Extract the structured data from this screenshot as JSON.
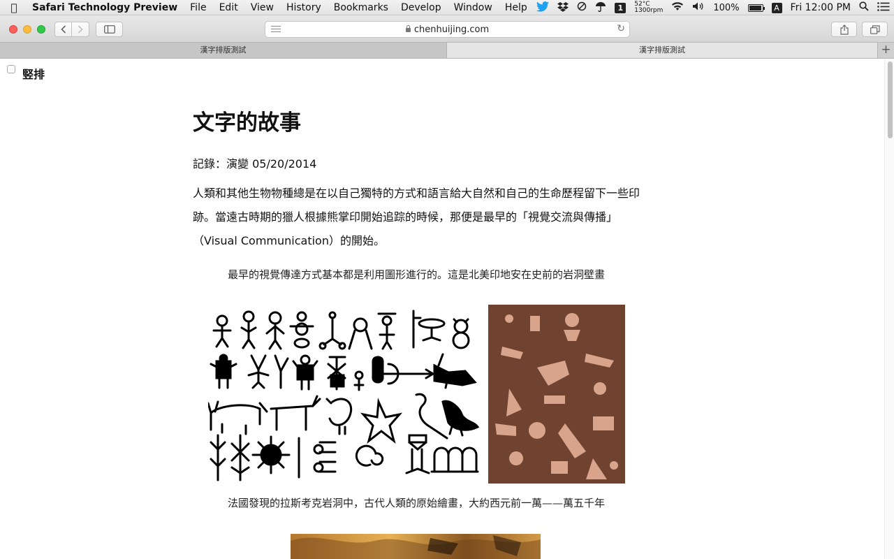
{
  "menubar": {
    "app_name": "Safari Technology Preview",
    "items": [
      "File",
      "Edit",
      "View",
      "History",
      "Bookmarks",
      "Develop",
      "Window",
      "Help"
    ],
    "status": {
      "temperature": "52°C",
      "fan": "1300rpm",
      "badge_number": "1",
      "battery": "100%",
      "input_source": "A",
      "clock": "Fri 12:00 PM"
    }
  },
  "toolbar": {
    "url": "chenhuijing.com"
  },
  "tabs": [
    {
      "label": "漢字排版測試",
      "active": false
    },
    {
      "label": "漢字排版測試",
      "active": true
    }
  ],
  "page": {
    "toggle_label": "竪排",
    "title": "文字的故事",
    "meta": "記錄：演變 05/20/2014",
    "paragraph": "人類和其他生物物種總是在以自己獨特的方式和語言給大自然和自己的生命歷程留下一些印跡。當遠古時期的獵人根據熊掌印開始追踪的時候，那便是最早的「視覺交流與傳播」（Visual Communication）的開始。",
    "caption_1": "最早的視覺傳達方式基本都是利用圖形進行的。這是北美印地安在史前的岩洞壁畫",
    "caption_2": "法國發現的拉斯考克岩洞中，古代人類的原始繪畫，大約西元前一萬——萬五千年"
  }
}
